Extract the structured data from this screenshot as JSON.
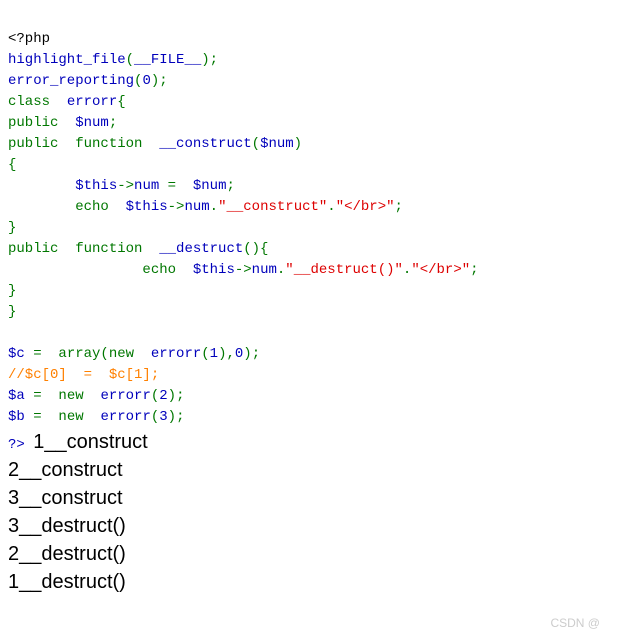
{
  "code": {
    "l1_open": "<?php",
    "l2_a": "highlight_file",
    "l2_b": "(",
    "l2_c": "__FILE__",
    "l2_d": ");",
    "l3_a": "error_reporting",
    "l3_b": "(",
    "l3_c": "0",
    "l3_d": ");",
    "l4_a": "class  ",
    "l4_b": "errorr",
    "l4_c": "{",
    "l5_a": "public  ",
    "l5_b": "$num",
    "l5_c": ";",
    "l6_a": "public  function  ",
    "l6_b": "__construct",
    "l6_c": "(",
    "l6_d": "$num",
    "l6_e": ")",
    "l7": "{",
    "l8_a": "        ",
    "l8_b": "$this",
    "l8_c": "->",
    "l8_d": "num ",
    "l8_e": "=  ",
    "l8_f": "$num",
    "l8_g": ";",
    "l9_a": "        echo  ",
    "l9_b": "$this",
    "l9_c": "->",
    "l9_d": "num",
    "l9_e": ".",
    "l9_f": "\"__construct\"",
    "l9_g": ".",
    "l9_h": "\"</br>\"",
    "l9_i": ";",
    "l10": "}",
    "l11_a": "public  function  ",
    "l11_b": "__destruct",
    "l11_c": "(){",
    "l12_a": "                echo  ",
    "l12_b": "$this",
    "l12_c": "->",
    "l12_d": "num",
    "l12_e": ".",
    "l12_f": "\"__destruct()\"",
    "l12_g": ".",
    "l12_h": "\"</br>\"",
    "l12_i": ";",
    "l13": "}",
    "l14": "}",
    "l16_a": "$c ",
    "l16_b": "=  array(new  ",
    "l16_c": "errorr",
    "l16_d": "(",
    "l16_e": "1",
    "l16_f": "),",
    "l16_g": "0",
    "l16_h": ");",
    "l17": "//$c[0]  =  $c[1];",
    "l18_a": "$a ",
    "l18_b": "=  new  ",
    "l18_c": "errorr",
    "l18_d": "(",
    "l18_e": "2",
    "l18_f": ");",
    "l19_a": "$b ",
    "l19_b": "=  new  ",
    "l19_c": "errorr",
    "l19_d": "(",
    "l19_e": "3",
    "l19_f": ");",
    "close": "?> "
  },
  "output": {
    "o1": "1__construct",
    "o2": "2__construct",
    "o3": "3__construct",
    "o4": "3__destruct()",
    "o5": "2__destruct()",
    "o6": "1__destruct()"
  },
  "watermark": "CSDN @"
}
